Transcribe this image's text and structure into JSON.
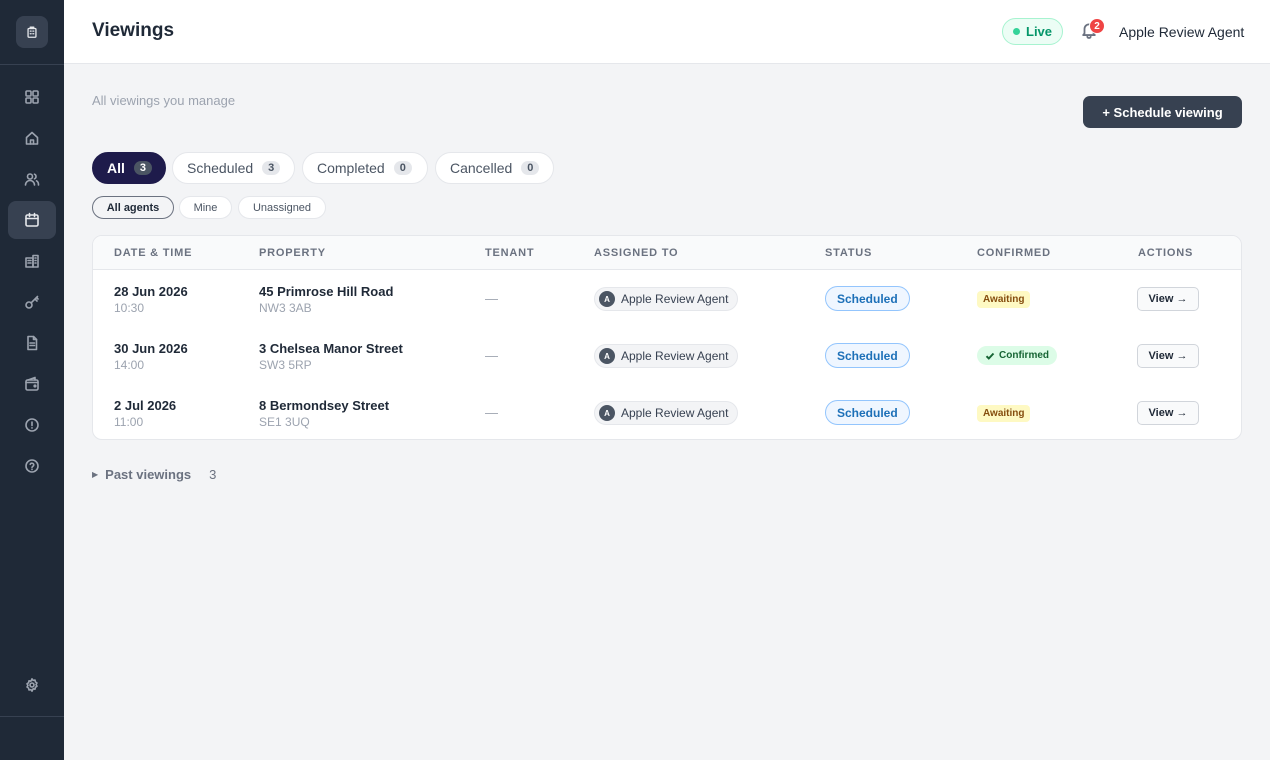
{
  "header": {
    "title": "Viewings",
    "live_label": "Live",
    "notification_count": "2",
    "user_name": "Apple Review Agent"
  },
  "main": {
    "subtitle": "All viewings you manage",
    "schedule_button": "+ Schedule viewing",
    "tabs": [
      {
        "label": "All",
        "count": "3"
      },
      {
        "label": "Scheduled",
        "count": "3"
      },
      {
        "label": "Completed",
        "count": "0"
      },
      {
        "label": "Cancelled",
        "count": "0"
      }
    ],
    "filters": [
      {
        "label": "All agents"
      },
      {
        "label": "Mine"
      },
      {
        "label": "Unassigned"
      }
    ],
    "table": {
      "headers": [
        "DATE & TIME",
        "PROPERTY",
        "TENANT",
        "ASSIGNED TO",
        "STATUS",
        "CONFIRMED",
        "ACTIONS"
      ],
      "rows": [
        {
          "date": "28 Jun 2026",
          "time": "10:30",
          "property": "45 Primrose Hill Road",
          "postcode": "NW3 3AB",
          "tenant": "—",
          "agent_initial": "A",
          "agent": "Apple Review Agent",
          "status": "Scheduled",
          "confirmed": "Awaiting",
          "action": "View →"
        },
        {
          "date": "30 Jun 2026",
          "time": "14:00",
          "property": "3 Chelsea Manor Street",
          "postcode": "SW3 5RP",
          "tenant": "—",
          "agent_initial": "A",
          "agent": "Apple Review Agent",
          "status": "Scheduled",
          "confirmed": "Confirmed",
          "action": "View →"
        },
        {
          "date": "2 Jul 2026",
          "time": "11:00",
          "property": "8 Bermondsey Street",
          "postcode": "SE1 3UQ",
          "tenant": "—",
          "agent_initial": "A",
          "agent": "Apple Review Agent",
          "status": "Scheduled",
          "confirmed": "Awaiting",
          "action": "View →"
        }
      ]
    },
    "past_viewings": {
      "label": "Past viewings",
      "count": "3"
    }
  },
  "sidebar": {
    "logo_icon": "building-icon",
    "items": [
      {
        "icon": "dashboard-icon"
      },
      {
        "icon": "home-icon"
      },
      {
        "icon": "users-icon"
      },
      {
        "icon": "calendar-icon",
        "active": true
      },
      {
        "icon": "buildings-icon"
      },
      {
        "icon": "key-icon"
      },
      {
        "icon": "document-icon"
      },
      {
        "icon": "wallet-icon"
      },
      {
        "icon": "alert-icon"
      },
      {
        "icon": "help-icon"
      }
    ],
    "bottom_icon": "settings-icon"
  },
  "colors": {
    "sidebar_bg": "#1f2937",
    "active_tab": "#1e1b4b",
    "primary_button": "#374151",
    "live_green": "#059669",
    "status_blue": "#1d70b8",
    "awaiting_yellow": "#fef9c3",
    "confirmed_green": "#dcfce7",
    "notification_red": "#ef4444"
  }
}
